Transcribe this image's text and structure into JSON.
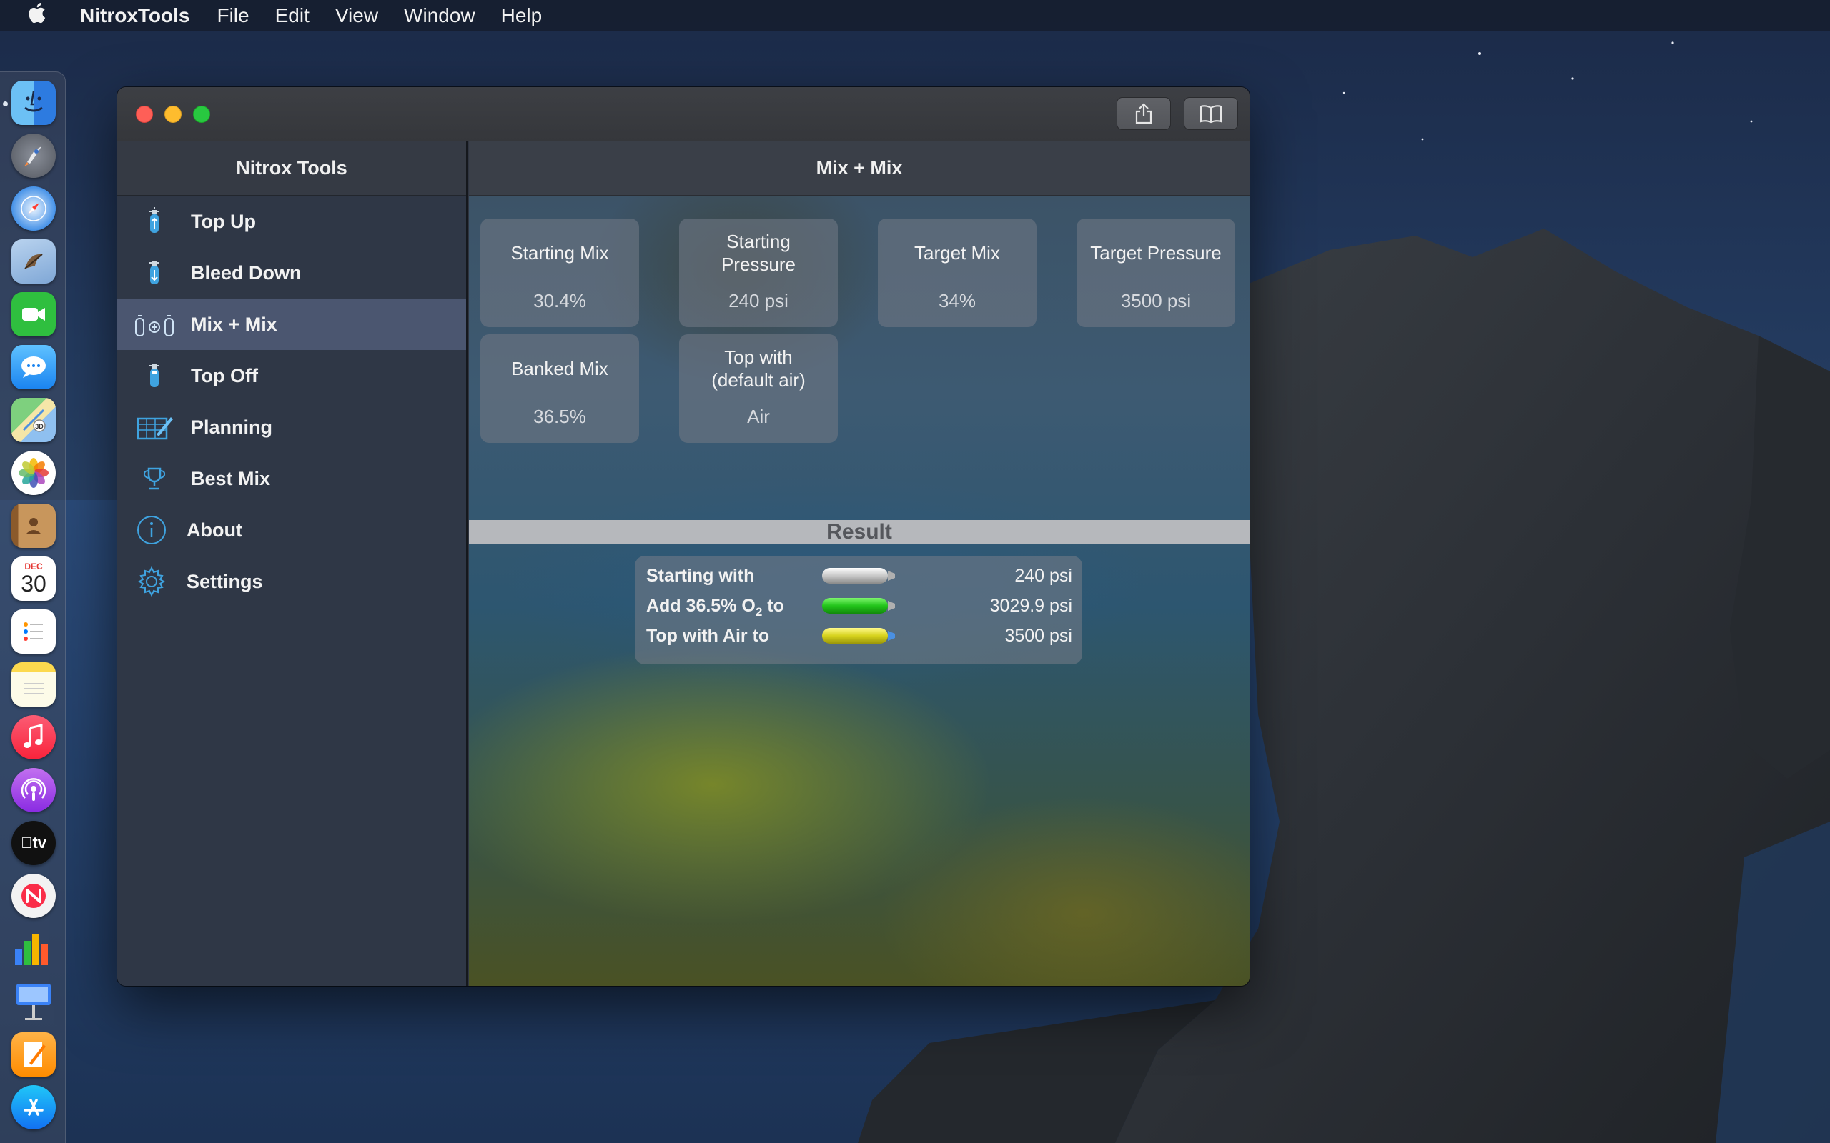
{
  "menubar": {
    "app_name": "NitroxTools",
    "items": [
      "File",
      "Edit",
      "View",
      "Window",
      "Help"
    ]
  },
  "dock": {
    "apps": [
      "finder-icon",
      "launchpad-icon",
      "safari-icon",
      "mail-icon",
      "facetime-icon",
      "messages-icon",
      "maps-icon",
      "photos-icon",
      "contacts-icon",
      "calendar-icon",
      "reminders-icon",
      "notes-icon",
      "music-icon",
      "podcasts-icon",
      "tv-icon",
      "news-icon",
      "numbers-icon",
      "keynote-icon",
      "pages-icon",
      "appstore-icon"
    ],
    "calendar": {
      "month": "DEC",
      "day": "30"
    },
    "tv_label": "tv"
  },
  "sidebar": {
    "title": "Nitrox Tools",
    "items": [
      {
        "label": "Top Up",
        "icon": "tank-up-icon"
      },
      {
        "label": "Bleed Down",
        "icon": "tank-down-icon"
      },
      {
        "label": "Mix + Mix",
        "icon": "mix-tanks-icon",
        "selected": true
      },
      {
        "label": "Top Off",
        "icon": "tank-top-icon"
      },
      {
        "label": "Planning",
        "icon": "planning-icon"
      },
      {
        "label": "Best Mix",
        "icon": "trophy-icon"
      },
      {
        "label": "About",
        "icon": "info-icon"
      },
      {
        "label": "Settings",
        "icon": "gear-icon"
      }
    ]
  },
  "content": {
    "title": "Mix + Mix",
    "tiles": [
      {
        "label": "Starting Mix",
        "value": "30.4%"
      },
      {
        "label": "Starting\nPressure",
        "value": "240 psi"
      },
      {
        "label": "Target Mix",
        "value": "34%"
      },
      {
        "label": "Target Pressure",
        "value": "3500 psi"
      },
      {
        "label": "Banked Mix",
        "value": "36.5%"
      },
      {
        "label": "Top with\n(default air)",
        "value": "Air"
      }
    ],
    "result_title": "Result",
    "results": [
      {
        "label": "Starting with",
        "value": "240 psi",
        "tank_color": "#c8c8c8"
      },
      {
        "label_prefix": "Add 36.5% O",
        "label_sub": "2",
        "label_suffix": " to",
        "value": "3029.9 psi",
        "tank_color": "#22c41a"
      },
      {
        "label": "Top with Air to",
        "value": "3500 psi",
        "tank_color": "#d6d21c"
      }
    ]
  },
  "colors": {
    "selected_row": "#4b5670",
    "sidebar_bg": "#2f3746",
    "close": "#fe5f57",
    "minimize": "#febc2e",
    "maximize": "#28c840"
  }
}
